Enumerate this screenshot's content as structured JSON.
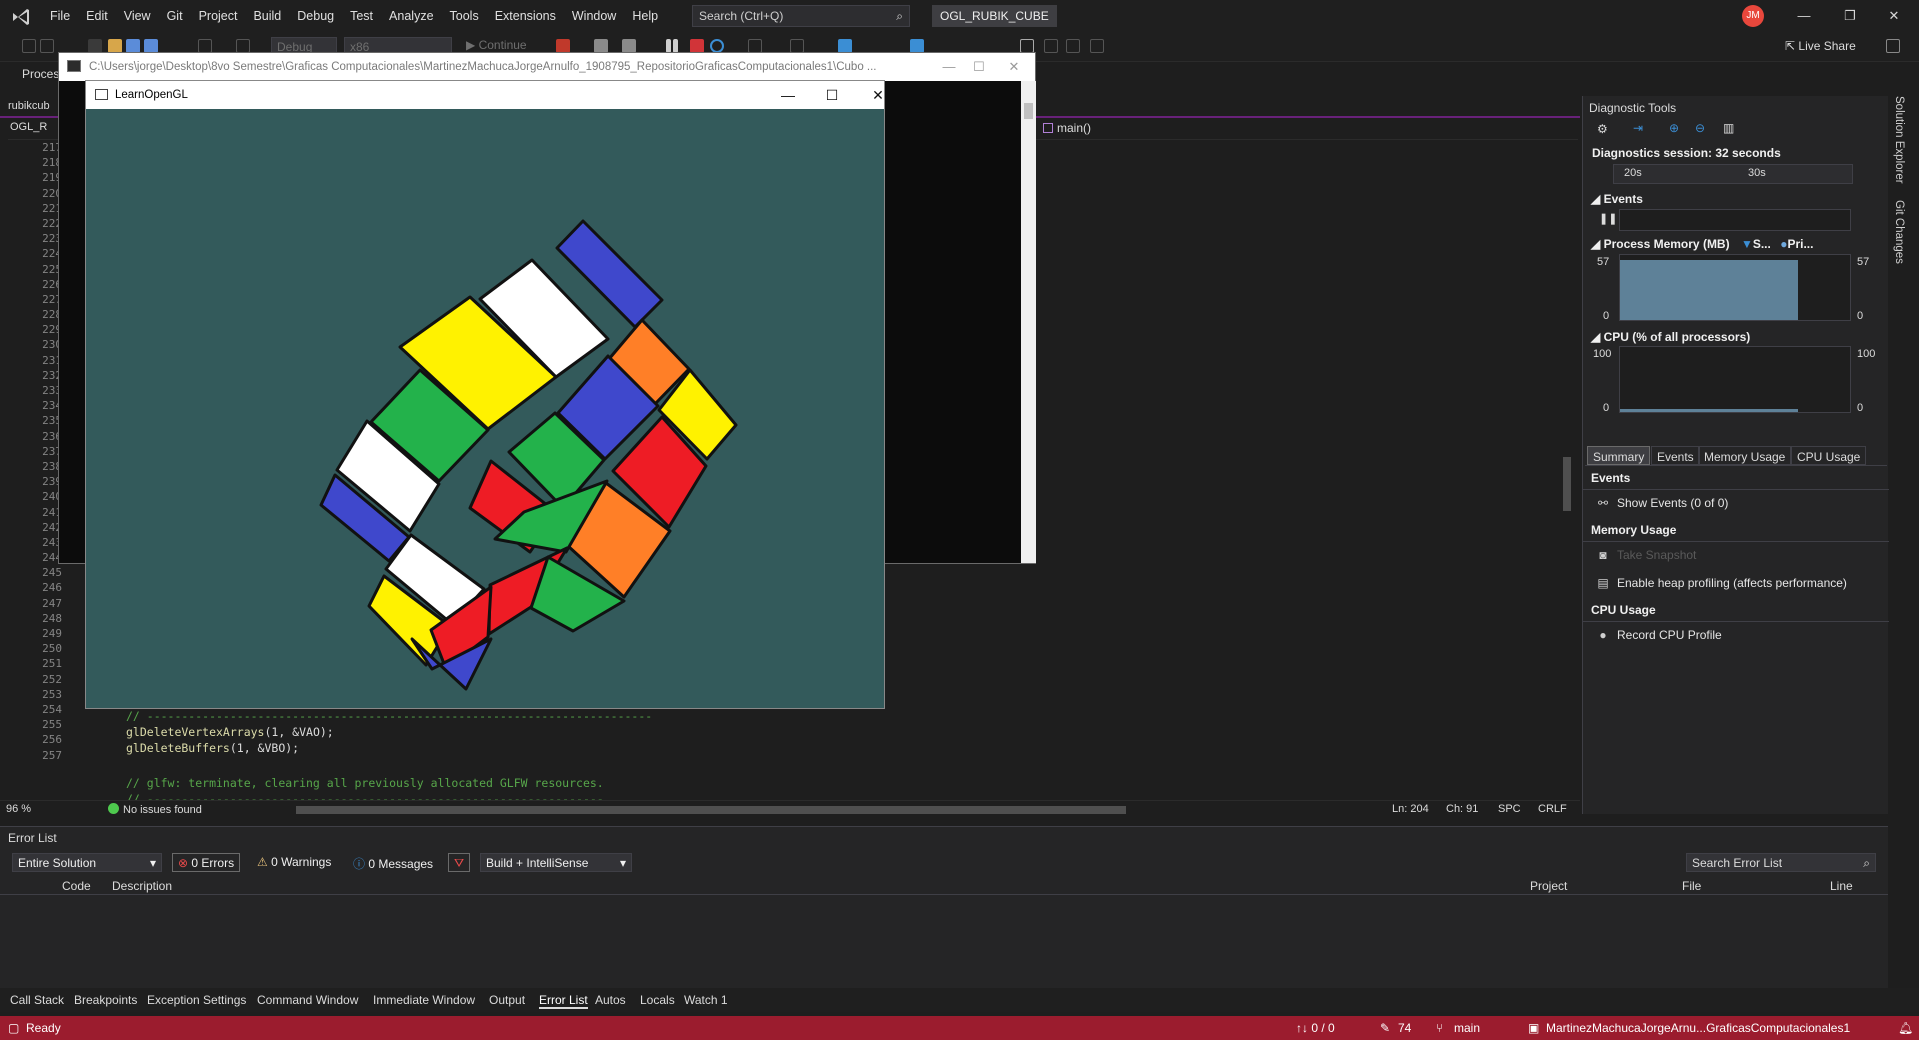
{
  "titlebar": {
    "menus": [
      "File",
      "Edit",
      "View",
      "Git",
      "Project",
      "Build",
      "Debug",
      "Test",
      "Analyze",
      "Tools",
      "Extensions",
      "Window",
      "Help"
    ],
    "search_placeholder": "Search (Ctrl+Q)",
    "project_name": "OGL_RUBIK_CUBE",
    "avatar_initials": "JM",
    "minimize": "—",
    "maximize": "❐",
    "close": "✕"
  },
  "toolbar": {
    "config": "Debug",
    "platform": "x86",
    "continue_label": "Continue",
    "live_share": "Live Share"
  },
  "left_panel": {
    "label": "Proces"
  },
  "editor": {
    "file_tab": "rubikcub",
    "project_nav": "OGL_R",
    "function_nav": "main()",
    "line_numbers": [
      "217",
      "218",
      "219",
      "220",
      "221",
      "222",
      "223",
      "224",
      "225",
      "226",
      "227",
      "228",
      "229",
      "230",
      "231",
      "232",
      "233",
      "234",
      "235",
      "236",
      "237",
      "238",
      "239",
      "240",
      "241",
      "242",
      "243",
      "244",
      "245",
      "246",
      "247",
      "248",
      "249",
      "250",
      "251",
      "252",
      "253",
      "254",
      "255",
      "256",
      "257"
    ],
    "code": {
      "l252": "// -------------------------------------------------------------------------",
      "l253a": "glDeleteVertexArrays",
      "l253b": "(1, &VAO);",
      "l254a": "glDeleteBuffers",
      "l254b": "(1, &VBO);",
      "l256": "// glfw: terminate, clearing all previously allocated GLFW resources.",
      "l257": "// ------------------------------------------------------------------"
    },
    "zoom": "96 %",
    "issues": "No issues found",
    "ln": "Ln: 204",
    "ch": "Ch: 91",
    "spc": "SPC",
    "crlf": "CRLF"
  },
  "console": {
    "path": "C:\\Users\\jorge\\Desktop\\8vo Semestre\\Graficas Computacionales\\MartinezMachucaJorgeArnulfo_1908795_RepositorioGraficasComputacionales1\\Cubo ...",
    "minimize": "—",
    "maximize": "☐",
    "close": "✕"
  },
  "glwindow": {
    "title": "LearnOpenGL",
    "minimize": "—",
    "maximize": "☐",
    "close": "✕",
    "background": "#335a5b"
  },
  "diagnostics": {
    "title": "Diagnostic Tools",
    "session": "Diagnostics session: 32 seconds",
    "ruler_labels": [
      "20s",
      "30s"
    ],
    "events_label": "Events",
    "memory_label": "Process Memory (MB)",
    "memory_legend": [
      "S...",
      "Pri..."
    ],
    "memory_max": "57",
    "memory_min": "0",
    "memory_level_fraction": 0.93,
    "cpu_label": "CPU (% of all processors)",
    "cpu_max": "100",
    "cpu_min": "0",
    "cpu_level_fraction": 0.04,
    "tabs": [
      "Summary",
      "Events",
      "Memory Usage",
      "CPU Usage"
    ],
    "summary": {
      "events_header": "Events",
      "show_events": "Show Events (0 of 0)",
      "memory_header": "Memory Usage",
      "take_snapshot": "Take Snapshot",
      "heap_profiling": "Enable heap profiling (affects performance)",
      "cpu_header": "CPU Usage",
      "record_cpu": "Record CPU Profile"
    },
    "colors": {
      "graph_fill": "#5e8198",
      "accent": "#3b8ed4"
    }
  },
  "side_tabs": [
    "Solution Explorer",
    "Git Changes"
  ],
  "error_list": {
    "title": "Error List",
    "scope": "Entire Solution",
    "errors": "0 Errors",
    "warnings": "0 Warnings",
    "messages": "0 Messages",
    "build_filter": "Build + IntelliSense",
    "search_placeholder": "Search Error List",
    "columns": [
      "Code",
      "Description",
      "Project",
      "File",
      "Line"
    ]
  },
  "tool_tabs": [
    "Call Stack",
    "Breakpoints",
    "Exception Settings",
    "Command Window",
    "Immediate Window",
    "Output",
    "Error List",
    "Autos",
    "Locals",
    "Watch 1"
  ],
  "statusbar": {
    "ready": "Ready",
    "sync": "↑↓ 0 / 0",
    "edits": "74",
    "branch": "main",
    "repo": "MartinezMachucaJorgeArnu...GraficasComputacionales1",
    "background": "#9b1c2e"
  },
  "rubik": {
    "colors": {
      "white": "#ffffff",
      "yellow": "#fff200",
      "green": "#23b24b",
      "red": "#ee1c25",
      "blue": "#3f48cc",
      "orange": "#ff7f27"
    }
  }
}
